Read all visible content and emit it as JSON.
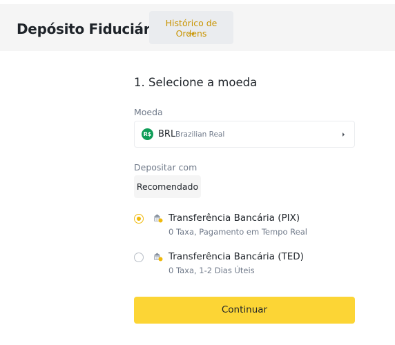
{
  "header": {
    "title": "Depósito Fiduciário",
    "history_button": {
      "label": "Histórico de Ordens",
      "arrow": "→"
    }
  },
  "step": {
    "title": "1. Selecione a moeda"
  },
  "currency": {
    "label": "Moeda",
    "icon_text": "R$",
    "icon_color": "#0f9d58",
    "code": "BRL",
    "name": "Brazilian Real",
    "icon": "caret-right-icon"
  },
  "deposit": {
    "label": "Depositar com",
    "tab": "Recomendado",
    "options": [
      {
        "title": "Transferência Bancária (PIX)",
        "desc": "0 Taxa, Pagamento em Tempo Real",
        "selected": true,
        "icon": "bank-transfer-icon"
      },
      {
        "title": "Transferência Bancária (TED)",
        "desc": "0 Taxa, 1-2 Dias Úteis",
        "selected": false,
        "icon": "bank-transfer-icon"
      }
    ]
  },
  "continue_button": {
    "label": "Continuar",
    "color": "#fcd535"
  },
  "colors": {
    "accent": "#f0b90b",
    "link": "#c99400",
    "text": "#1e2329",
    "muted": "#707a8a"
  }
}
